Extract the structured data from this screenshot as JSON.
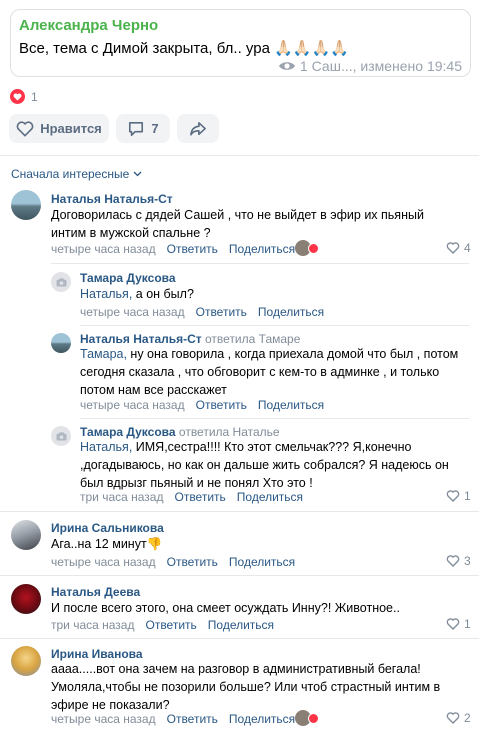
{
  "quote": {
    "author": "Александра Черно",
    "text": "Все, тема с Димой закрыта, бл.. ура 🙏🏻🙏🏻🙏🏻🙏🏻",
    "views": "1",
    "meta": "Саш..., изменено 19:45"
  },
  "reactions": {
    "count": "1"
  },
  "actions": {
    "like_label": "Нравится",
    "comments_count": "7"
  },
  "sort": {
    "label": "Сначала интересные"
  },
  "comments": [
    {
      "author": "Наталья Наталья-Ст",
      "text": "Договорилась с дядей Сашей , что не выйдет в эфир их пьяный интим в мужской спальне ?",
      "time": "четыре часа назад",
      "reply": "Ответить",
      "share": "Поделиться",
      "likes": "4"
    },
    {
      "author": "Тамара Дуксова",
      "mention": "Наталья,",
      "text": " а он был?",
      "time": "четыре часа назад",
      "reply": "Ответить",
      "share": "Поделиться"
    },
    {
      "author": "Наталья Наталья-Ст",
      "replied_to": "ответила Тамаре",
      "mention": "Тамара,",
      "text": " ну она говорила , когда приехала домой что был , потом сегодня сказала , что обговорит с кем-то в админке , и только потом нам все расскажет",
      "time": "четыре часа назад",
      "reply": "Ответить",
      "share": "Поделиться"
    },
    {
      "author": "Тамара Дуксова",
      "replied_to": "ответила Наталье",
      "mention": "Наталья,",
      "text": " ИМЯ,сестра!!!! Кто этот смельчак??? Я,конечно ,догадываюсь, но как он дальше жить собрался? Я надеюсь он был вдрызг пьяный и не понял Хто это !",
      "time": "три часа назад",
      "reply": "Ответить",
      "share": "Поделиться",
      "likes": "1"
    },
    {
      "author": "Ирина Сальникова",
      "text": "Ага..на 12 минут👎",
      "time": "четыре часа назад",
      "reply": "Ответить",
      "share": "Поделиться",
      "likes": "3"
    },
    {
      "author": "Наталья Деева",
      "text": "И после всего этого, она смеет осуждать Инну?! Животное..",
      "time": "три часа назад",
      "reply": "Ответить",
      "share": "Поделиться",
      "likes": "1"
    },
    {
      "author": "Ирина Иванова",
      "text": "аааа.....вот она зачем на разговор в административный бегала! Умоляла,чтобы не позорили больше? Или чтоб страстный интим в эфире не показали?",
      "time": "четыре часа назад",
      "reply": "Ответить",
      "share": "Поделиться",
      "likes": "2"
    }
  ],
  "icons": {
    "eye": "eye-icon",
    "heart": "heart-icon",
    "comment": "comment-icon",
    "share": "share-icon",
    "chevron": "chevron-down-icon",
    "camera": "camera-icon"
  },
  "colors": {
    "link": "#2a5885",
    "quote_author": "#4bb34b",
    "muted": "#818c99",
    "reaction": "#ff3347"
  }
}
